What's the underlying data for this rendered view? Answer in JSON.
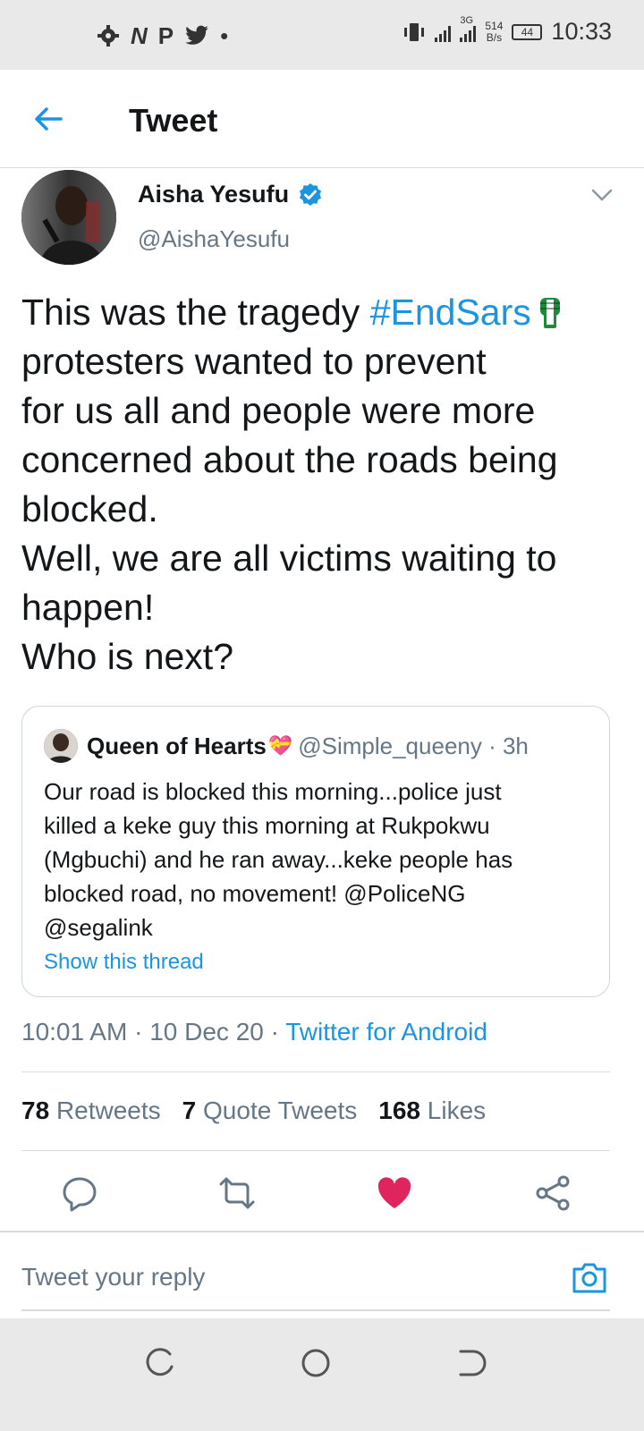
{
  "status_bar": {
    "time": "10:33",
    "network": "3G",
    "speed_value": "514",
    "speed_unit": "B/s",
    "battery": "44",
    "left_icons": [
      "gear-icon",
      "n-icon",
      "p-icon",
      "twitter-icon",
      "dot-icon"
    ]
  },
  "header": {
    "title": "Tweet"
  },
  "author": {
    "name": "Aisha Yesufu",
    "handle": "@AishaYesufu",
    "verified": true
  },
  "tweet": {
    "lines": [
      "This was the tragedy ",
      "protesters wanted to prevent",
      "for us all and people were more",
      "concerned about the roads being",
      "blocked.",
      "Well, we are all victims waiting to",
      "happen!",
      "Who is next?"
    ],
    "hashtag": "#EndSars"
  },
  "quote": {
    "name": "Queen of Hearts",
    "heart_emoji": "💝",
    "handle": "@Simple_queeny · 3h",
    "lines": [
      "Our road is blocked this morning...police just",
      "killed a keke guy this morning at Rukpokwu",
      "(Mgbuchi) and he ran away...keke people has",
      "blocked road, no movement! @PoliceNG",
      "@segalink"
    ],
    "show_thread": "Show this thread"
  },
  "meta": {
    "time": "10:01 AM",
    "separator": " · ",
    "date": "10 Dec 20",
    "source": "Twitter for Android"
  },
  "stats": {
    "retweets_count": "78",
    "retweets_label": "Retweets",
    "quotes_count": "7",
    "quotes_label": "Quote Tweets",
    "likes_count": "168",
    "likes_label": "Likes"
  },
  "reply": {
    "placeholder": "Tweet your reply"
  },
  "colors": {
    "accent": "#1b95e0",
    "like": "#e0245e",
    "muted": "#657786",
    "text": "#14171a"
  }
}
